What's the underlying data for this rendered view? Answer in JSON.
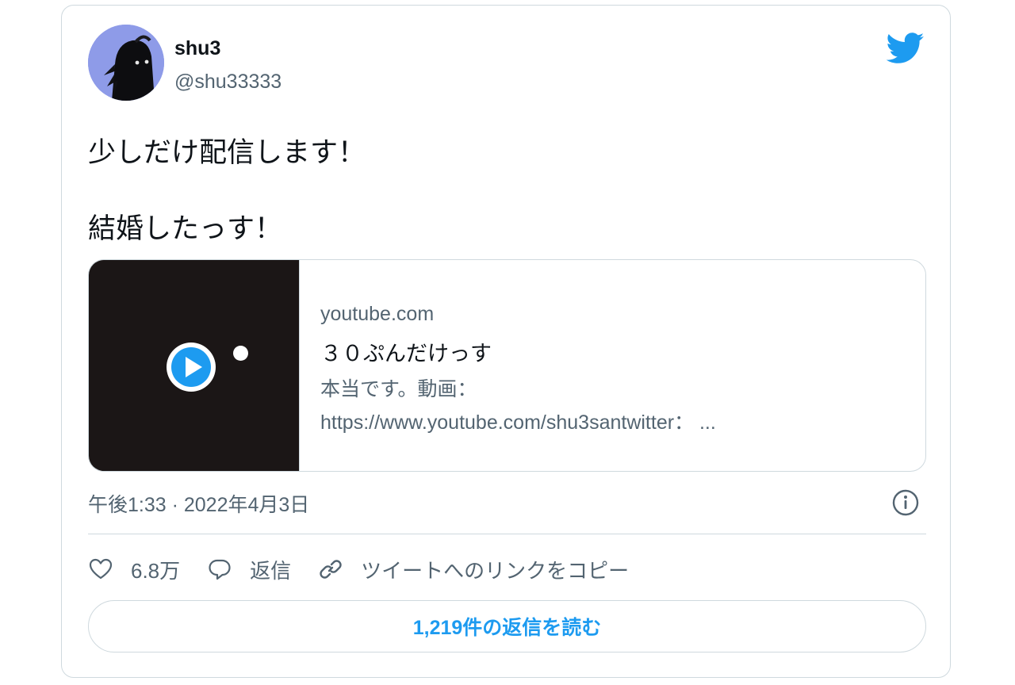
{
  "author": {
    "display_name": "shu3",
    "handle": "@shu33333"
  },
  "tweet": {
    "lines": [
      "少しだけ配信します！",
      "結婚したっす！"
    ]
  },
  "link_card": {
    "domain": "youtube.com",
    "title": "３０ぷんだけっす",
    "description_line1": "本当です。動画：",
    "description_line2": "https://www.youtube.com/shu3santwitter： ..."
  },
  "meta": {
    "timestamp": "午後1:33 · 2022年4月3日"
  },
  "actions": {
    "like_count": "6.8万",
    "reply_label": "返信",
    "copy_link_label": "ツイートへのリンクをコピー"
  },
  "read_replies_label": "1,219件の返信を読む",
  "icons": {
    "brand": "twitter-bird-icon",
    "play": "play-icon",
    "info": "info-icon",
    "like": "heart-icon",
    "reply": "speech-bubble-icon",
    "link": "link-icon"
  },
  "colors": {
    "twitter_blue": "#1d9bf0",
    "text_primary": "#0f1419",
    "text_secondary": "#536471",
    "border": "#cfd9de",
    "thumbnail_bg": "#1b1616"
  }
}
